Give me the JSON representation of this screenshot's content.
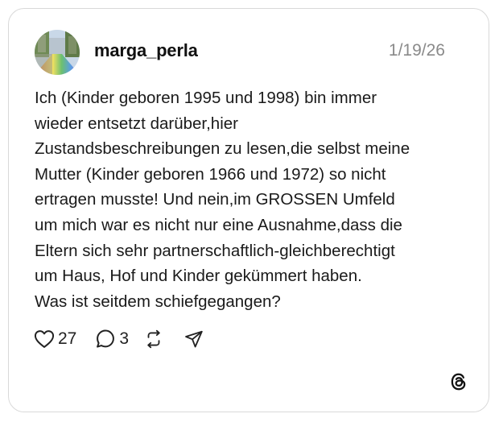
{
  "post": {
    "author": "marga_perla",
    "date": "1/19/26",
    "avatar_icon": "avatar-photo",
    "body_lines": [
      "Ich (Kinder geboren 1995 und 1998) bin immer",
      "wieder entsetzt darüber,hier",
      "Zustandsbeschreibungen zu lesen,die selbst meine",
      "Mutter (Kinder geboren 1966 und 1972) so nicht",
      "ertragen musste! Und nein,im GROSSEN Umfeld",
      "um mich war es nicht nur eine Ausnahme,dass die",
      "Eltern sich sehr partnerschaftlich-gleichberechtigt",
      "um Haus, Hof und Kinder gekümmert haben.",
      "Was ist seitdem schiefgegangen?"
    ]
  },
  "actions": {
    "like_count": "27",
    "reply_count": "3",
    "like_icon": "heart-icon",
    "reply_icon": "speech-bubble-icon",
    "repost_icon": "repost-icon",
    "share_icon": "send-icon"
  },
  "branding": {
    "logo_icon": "threads-logo-icon"
  },
  "colors": {
    "card_border": "#d9d9d9",
    "text": "#1a1a1a",
    "muted": "#8a8a8a",
    "icon": "#222222"
  }
}
